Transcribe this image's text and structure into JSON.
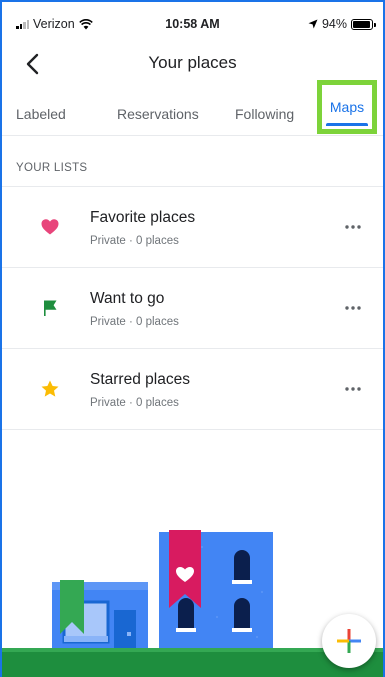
{
  "status_bar": {
    "carrier": "Verizon",
    "time": "10:58 AM",
    "battery": "94%",
    "battery_level": 0.94
  },
  "header": {
    "title": "Your places",
    "back_icon": "chevron-left-icon"
  },
  "tabs": [
    {
      "label": "Labeled"
    },
    {
      "label": "Reservations"
    },
    {
      "label": "Following"
    },
    {
      "label": "Maps",
      "selected": true
    }
  ],
  "lists": {
    "section_label": "YOUR LISTS",
    "items": [
      {
        "name": "Favorite places",
        "meta": "Private · 0 places",
        "icon": "heart-icon",
        "color": "#e8457b"
      },
      {
        "name": "Want to go",
        "meta": "Private · 0 places",
        "icon": "flag-icon",
        "color": "#1e8e3e"
      },
      {
        "name": "Starred places",
        "meta": "Private · 0 places",
        "icon": "star-icon",
        "color": "#fbbc04"
      }
    ]
  },
  "colors": {
    "accent": "#1a73e8",
    "highlight": "#7dd33a"
  }
}
